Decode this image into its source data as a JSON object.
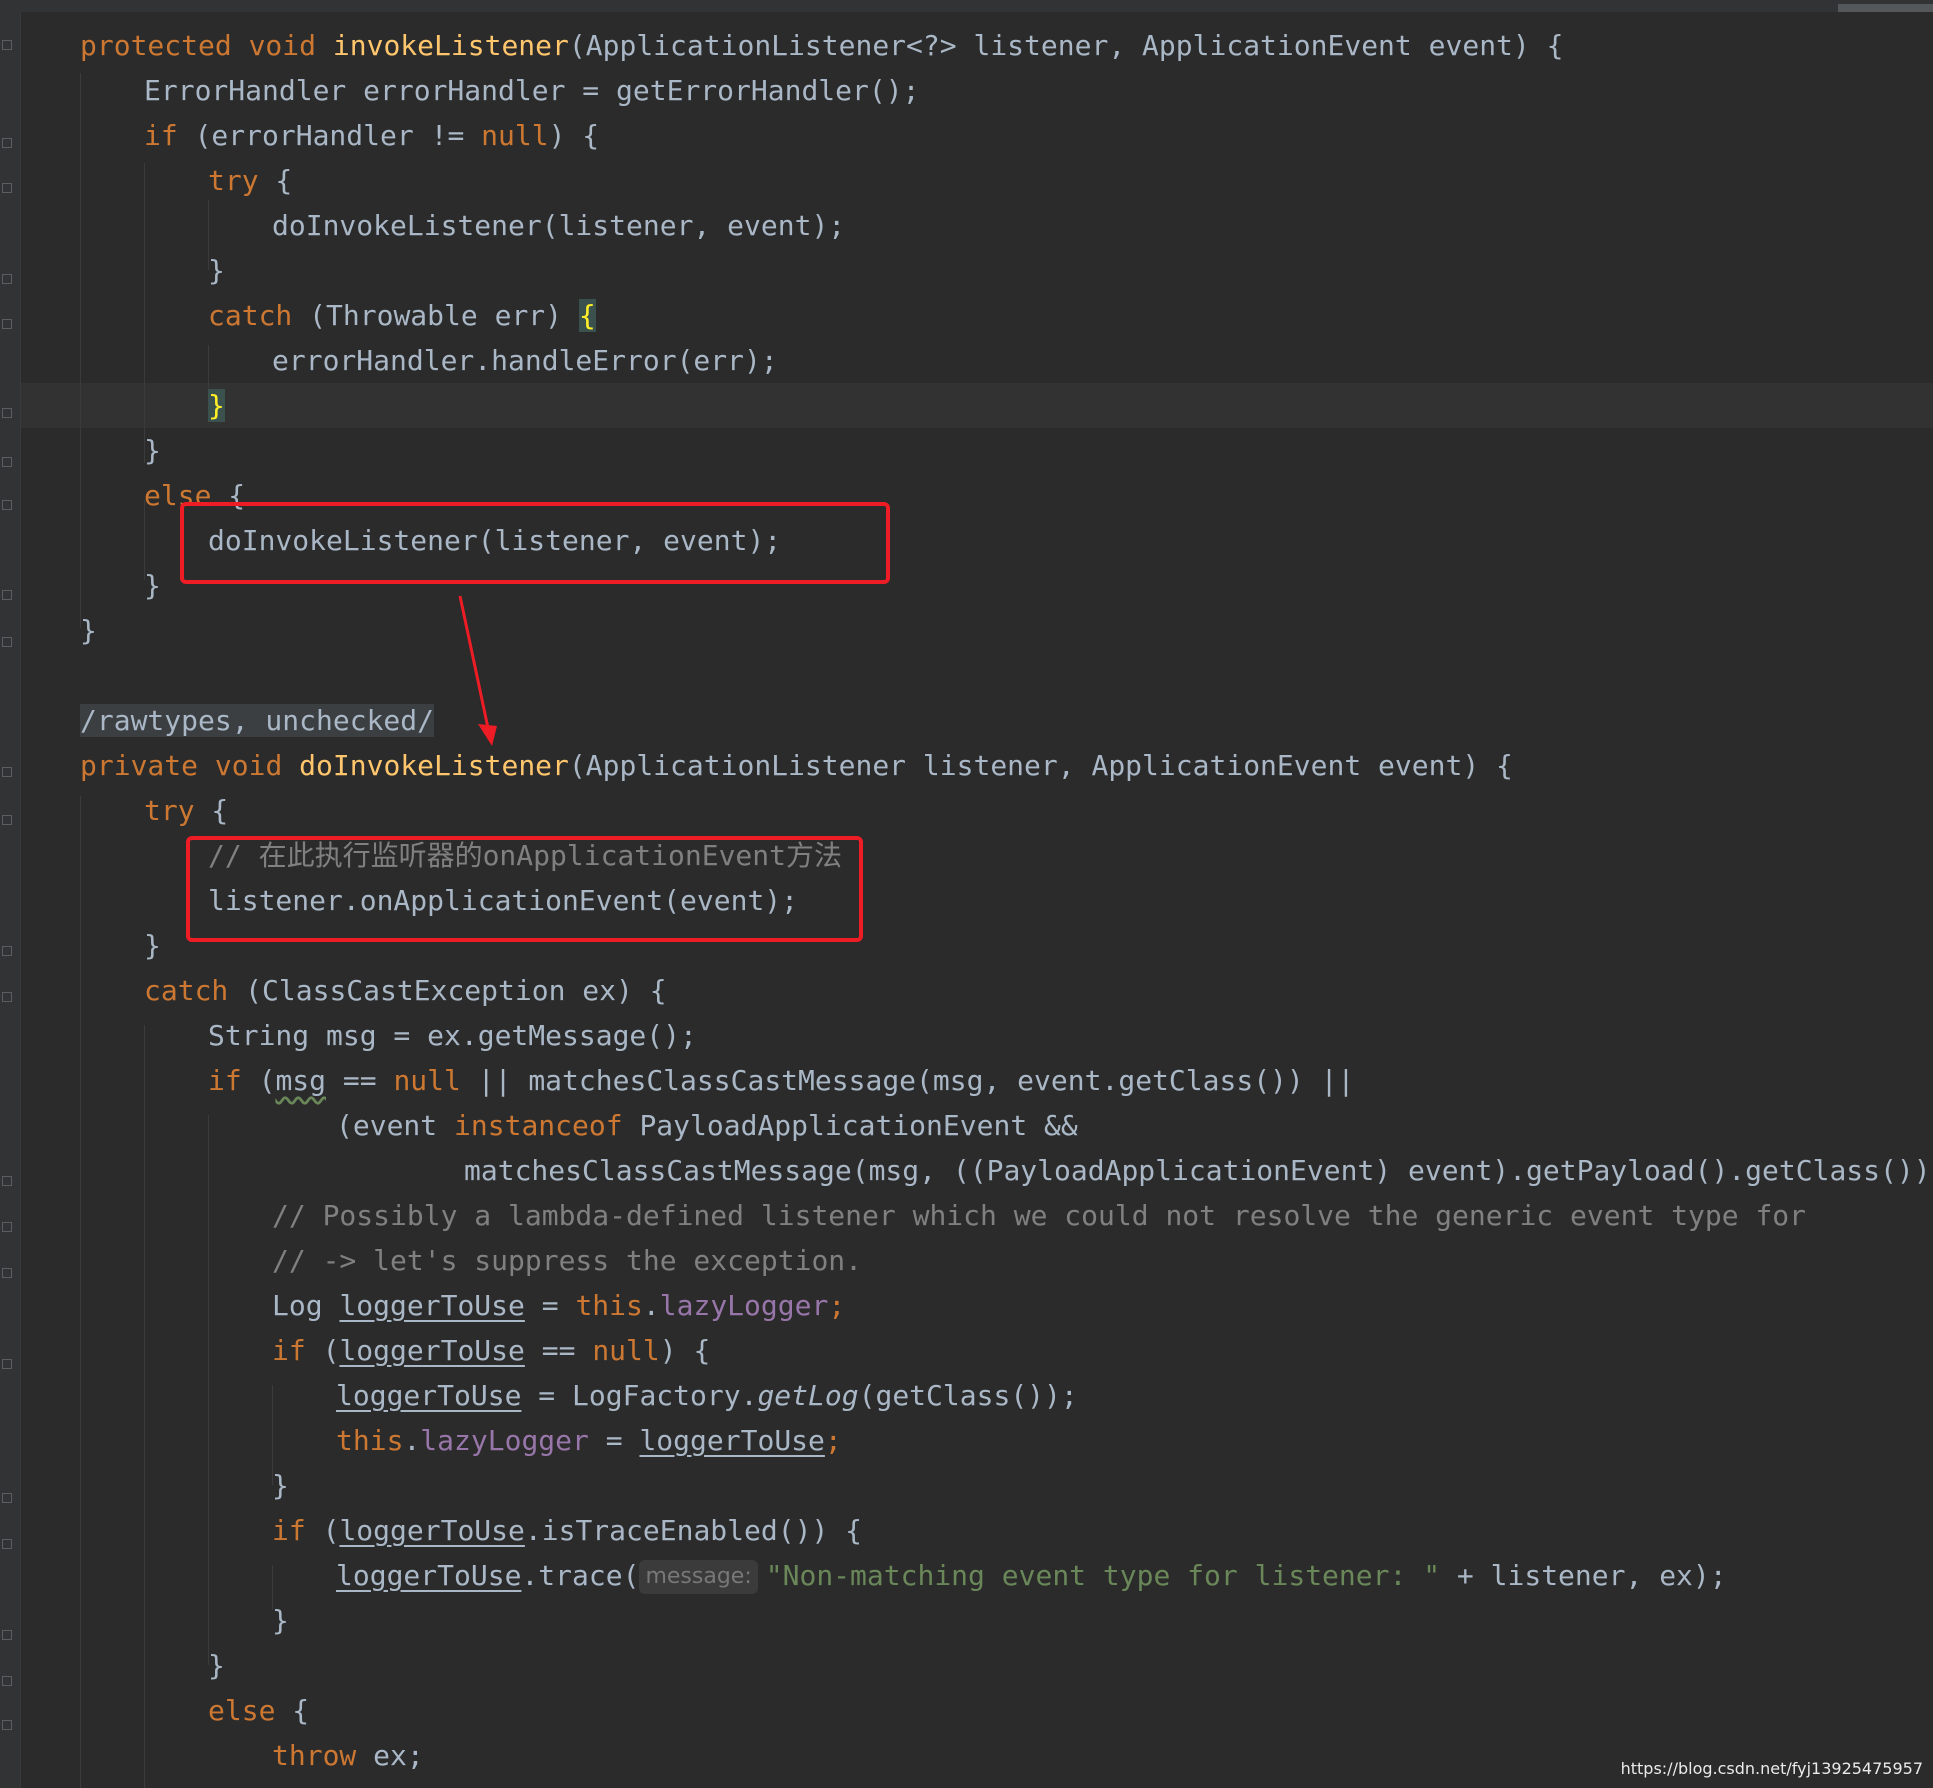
{
  "editor": {
    "colors": {
      "background": "#2b2b2b",
      "keyword": "#cc7832",
      "method_declaration": "#ffc66d",
      "comment": "#808080",
      "string": "#6a8759",
      "field": "#9876aa",
      "default_text": "#a9b7c6",
      "annotation_box": "#ee1c25"
    },
    "lines": {
      "l1": {
        "kw1": "protected",
        "kw2": "void",
        "name": "invokeListener",
        "rest": "(ApplicationListener<?> listener, ApplicationEvent event) {"
      },
      "l2": {
        "text": "ErrorHandler errorHandler = getErrorHandler();"
      },
      "l3": {
        "kw": "if",
        "mid": " (errorHandler != ",
        "kw2": "null",
        "rest": ") {"
      },
      "l4": {
        "kw": "try",
        "rest": " {"
      },
      "l5": {
        "text": "doInvokeListener(listener, event);"
      },
      "l6": {
        "text": "}"
      },
      "l7": {
        "kw": "catch",
        "rest": " (Throwable err) ",
        "brace": "{"
      },
      "l8": {
        "text": "errorHandler.handleError(err);"
      },
      "l9": {
        "brace": "}"
      },
      "l10": {
        "text": "}"
      },
      "l11": {
        "kw": "else",
        "rest": " {"
      },
      "l12": {
        "text": "doInvokeListener(listener, event);"
      },
      "l13": {
        "text": "}"
      },
      "l14": {
        "text": "}"
      },
      "l15": {
        "text": "/rawtypes, unchecked/"
      },
      "l16": {
        "kw1": "private",
        "kw2": "void",
        "name": "doInvokeListener",
        "rest": "(ApplicationListener listener, ApplicationEvent event) {"
      },
      "l17": {
        "kw": "try",
        "rest": " {"
      },
      "l18": {
        "text": "// 在此执行监听器的onApplicationEvent方法"
      },
      "l19": {
        "text": "listener.onApplicationEvent(event);"
      },
      "l20": {
        "text": "}"
      },
      "l21": {
        "kw": "catch",
        "rest": " (ClassCastException ex) {"
      },
      "l22": {
        "text": "String msg = ex.getMessage();"
      },
      "l23": {
        "kw": "if",
        "p1": " (",
        "msg": "msg",
        "p2": " == ",
        "kw2": "null",
        "rest": " || matchesClassCastMessage(msg, event.getClass()) ||"
      },
      "l24": {
        "pre": "(event ",
        "kw": "instanceof",
        "rest": " PayloadApplicationEvent &&"
      },
      "l25": {
        "text": "matchesClassCastMessage(msg, ((PayloadApplicationEvent) event).getPayload().getClass()))) {"
      },
      "l26": {
        "text": "// Possibly a lambda-defined listener which we could not resolve the generic event type for"
      },
      "l27": {
        "text": "// -> let's suppress the exception."
      },
      "l28": {
        "pre": "Log ",
        "var": "loggerToUse",
        "eq": " = ",
        "kw": "this",
        "dot": ".",
        "field": "lazyLogger",
        "end": ";"
      },
      "l29": {
        "kw": "if",
        "p1": " (",
        "var": "loggerToUse",
        "p2": " == ",
        "kw2": "null",
        "rest": ") {"
      },
      "l30": {
        "var": "loggerToUse",
        "mid": " = LogFactory.",
        "method": "getLog",
        "rest": "(getClass());"
      },
      "l31": {
        "kw": "this",
        "dot": ".",
        "field": "lazyLogger",
        "eq": " = ",
        "var": "loggerToUse",
        "end": ";"
      },
      "l32": {
        "text": "}"
      },
      "l33": {
        "kw": "if",
        "p1": " (",
        "var": "loggerToUse",
        "rest": ".isTraceEnabled()) {"
      },
      "l34": {
        "var": "loggerToUse",
        "mid": ".trace(",
        "hint": "message:",
        "str": "\"Non-matching event type for listener: \"",
        "rest": " + listener, ex);"
      },
      "l35": {
        "text": "}"
      },
      "l36": {
        "text": "}"
      },
      "l37": {
        "kw": "else",
        "rest": " {"
      },
      "l38": {
        "kw": "throw",
        "rest": " ex;"
      }
    }
  },
  "watermark": "https://blog.csdn.net/fyj13925475957"
}
